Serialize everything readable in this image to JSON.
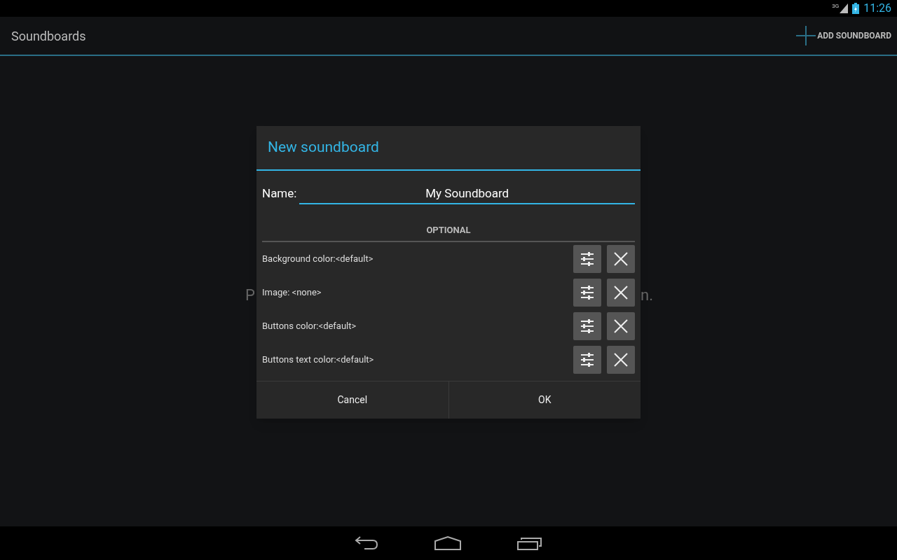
{
  "status_bar": {
    "network": "3G",
    "time": "11:26"
  },
  "action_bar": {
    "title": "Soundboards",
    "action": "ADD SOUNDBOARD"
  },
  "background_message": {
    "fragments": [
      "P",
      "n."
    ]
  },
  "dialog": {
    "title": "New soundboard",
    "name_label": "Name:",
    "name_value": "My Soundboard",
    "section": "OPTIONAL",
    "options": [
      {
        "label": "Background color:<default>"
      },
      {
        "label": "Image: <none>"
      },
      {
        "label": "Buttons color:<default>"
      },
      {
        "label": "Buttons text color:<default>"
      }
    ],
    "buttons": [
      "Cancel",
      "OK"
    ]
  }
}
